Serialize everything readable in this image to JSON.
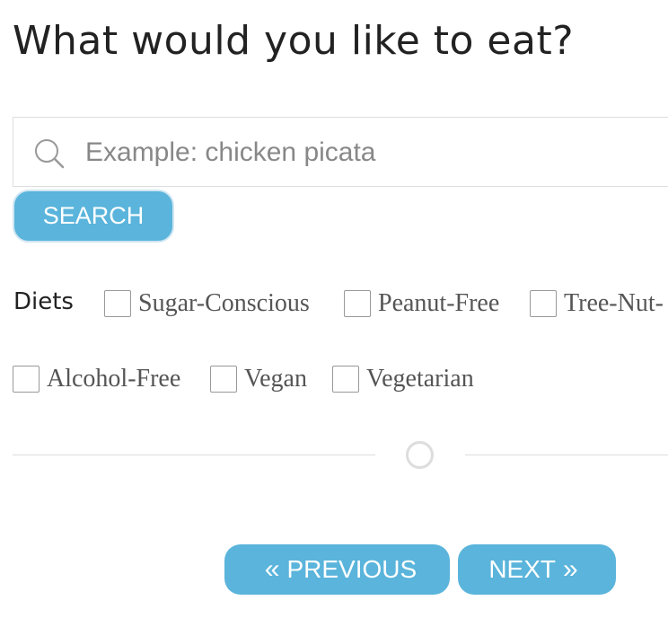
{
  "title": "What would you like to eat?",
  "search": {
    "icon": "search-icon",
    "placeholder": "Example: chicken picata",
    "value": "",
    "button_label": "SEARCH"
  },
  "diets": {
    "label": "Diets",
    "options": [
      {
        "label": "Sugar-Conscious",
        "checked": false
      },
      {
        "label": "Peanut-Free",
        "checked": false
      },
      {
        "label": "Tree-Nut-",
        "checked": false
      },
      {
        "label": "Alcohol-Free",
        "checked": false
      },
      {
        "label": "Vegan",
        "checked": false
      },
      {
        "label": "Vegetarian",
        "checked": false
      }
    ]
  },
  "navigation": {
    "previous_icon": "«",
    "previous_label": "PREVIOUS",
    "next_label": "NEXT",
    "next_icon": "»"
  },
  "colors": {
    "accent": "#5ab4db",
    "text": "#222222",
    "muted": "#888888",
    "border": "#dddddd"
  }
}
